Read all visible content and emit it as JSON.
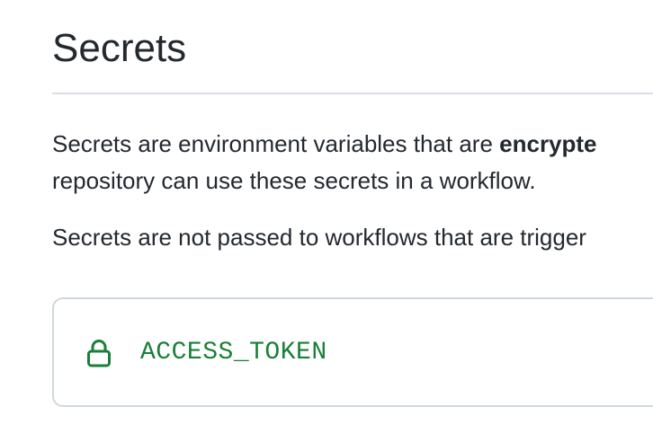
{
  "page": {
    "title": "Secrets"
  },
  "description": {
    "line1_prefix": "Secrets are environment variables that are ",
    "line1_bold": "encrypte",
    "line2": "repository can use these secrets in a workflow.",
    "line3": "Secrets are not passed to workflows that are trigger"
  },
  "secrets": {
    "items": [
      {
        "name": "ACCESS_TOKEN",
        "icon": "lock-icon"
      }
    ]
  },
  "colors": {
    "secret_name": "#1a7f37",
    "border": "#d0d7de",
    "text": "#24292f"
  }
}
